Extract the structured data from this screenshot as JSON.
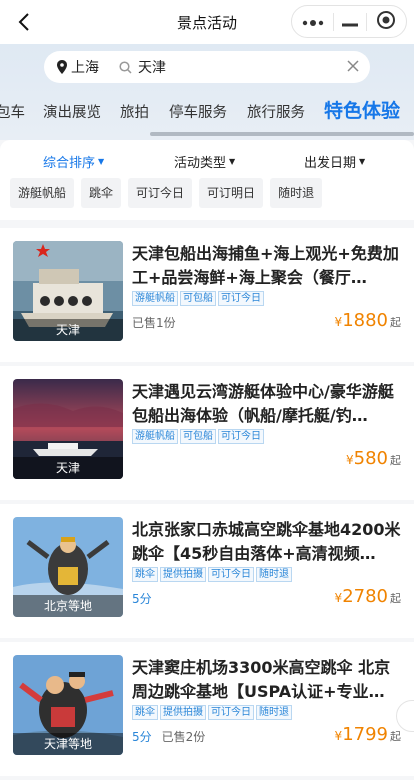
{
  "header": {
    "title": "景点活动"
  },
  "search": {
    "city": "上海",
    "keyword": "天津"
  },
  "categories": [
    {
      "label": "包车",
      "active": false
    },
    {
      "label": "演出展览",
      "active": false
    },
    {
      "label": "旅拍",
      "active": false
    },
    {
      "label": "停车服务",
      "active": false
    },
    {
      "label": "旅行服务",
      "active": false
    },
    {
      "label": "特色体验",
      "active": true
    }
  ],
  "sorts": [
    {
      "label": "综合排序",
      "active": true
    },
    {
      "label": "活动类型",
      "active": false
    },
    {
      "label": "出发日期",
      "active": false
    }
  ],
  "chips": [
    "游艇帆船",
    "跳伞",
    "可订今日",
    "可订明日",
    "随时退"
  ],
  "items": [
    {
      "title": "天津包船出海捕鱼+海上观光+免费加工+品尝海鲜+海上聚会（餐厅…",
      "location": "天津",
      "tags": [
        "游艇帆船",
        "可包船",
        "可订今日"
      ],
      "score": "",
      "sold": "已售1份",
      "price": "1880",
      "currency": "¥",
      "price_suffix": "起"
    },
    {
      "title": "天津遇见云湾游艇体验中心/豪华游艇包船出海体验（帆船/摩托艇/钓…",
      "location": "天津",
      "tags": [
        "游艇帆船",
        "可包船",
        "可订今日"
      ],
      "score": "",
      "sold": "",
      "price": "580",
      "currency": "¥",
      "price_suffix": "起"
    },
    {
      "title": "北京张家口赤城高空跳伞基地4200米跳伞【45秒自由落体+高清视频…",
      "location": "北京等地",
      "tags": [
        "跳伞",
        "提供拍摄",
        "可订今日",
        "随时退"
      ],
      "score": "5分",
      "sold": "",
      "price": "2780",
      "currency": "¥",
      "price_suffix": "起"
    },
    {
      "title": "天津窦庄机场3300米高空跳伞 北京周边跳伞基地【USPA认证+专业…",
      "location": "天津等地",
      "tags": [
        "跳伞",
        "提供拍摄",
        "可订今日",
        "随时退"
      ],
      "score": "5分",
      "sold": "已售2份",
      "price": "1799",
      "currency": "¥",
      "price_suffix": "起"
    }
  ],
  "colors": {
    "accent": "#1677e8",
    "price": "#f08300",
    "tag": "#2a86d8"
  }
}
